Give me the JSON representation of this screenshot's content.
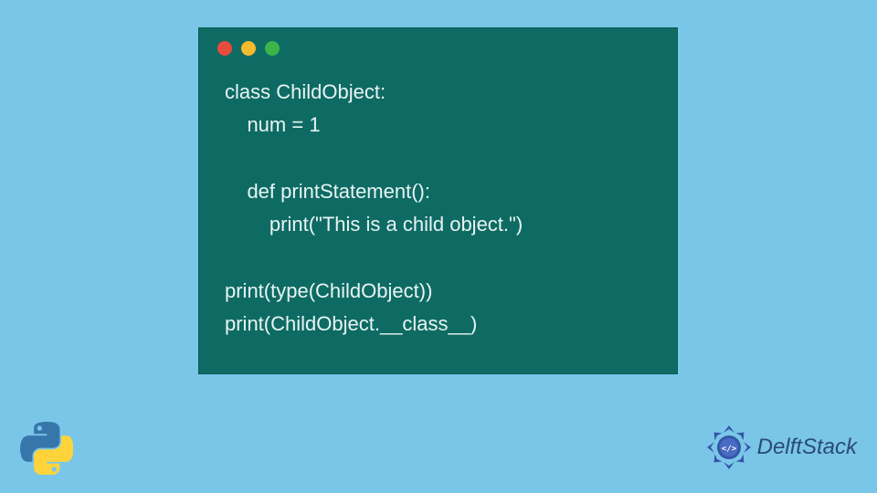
{
  "code": {
    "line1": "class ChildObject:",
    "line2": "    num = 1",
    "line3": "",
    "line4": "    def printStatement():",
    "line5": "        print(\"This is a child object.\")",
    "line6": "",
    "line7": "print(type(ChildObject))",
    "line8": "print(ChildObject.__class__)"
  },
  "brand": {
    "name": "DelftStack"
  },
  "colors": {
    "background": "#7ac6e8",
    "codeWindow": "#0e6b64",
    "codeText": "#e8f4f3",
    "brandText": "#2a4a7a",
    "red": "#e94b3c",
    "yellow": "#f5bb2f",
    "green": "#3bb54a"
  }
}
